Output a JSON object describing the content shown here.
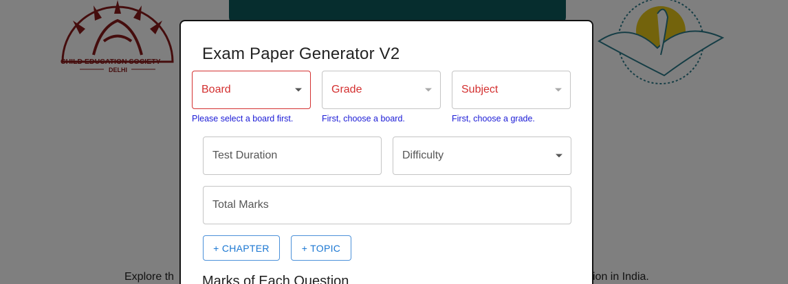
{
  "background": {
    "left_logo_text": "CHILD EDUCATION SOCIETY",
    "left_logo_sub": "DELHI",
    "intro_left": "Explore th",
    "intro_right": "ion in India."
  },
  "modal": {
    "title": "Exam Paper Generator V2",
    "board": {
      "label": "Board",
      "helper": "Please select a board first."
    },
    "grade": {
      "label": "Grade",
      "helper": "First, choose a board."
    },
    "subject": {
      "label": "Subject",
      "helper": "First, choose a grade."
    },
    "test_duration": {
      "placeholder": "Test Duration"
    },
    "difficulty": {
      "label": "Difficulty"
    },
    "total_marks": {
      "placeholder": "Total Marks"
    },
    "add_chapter_label": "+ CHAPTER",
    "add_topic_label": "+ TOPIC",
    "marks_section_heading": "Marks of Each Question"
  },
  "colors": {
    "error": "#d32f2f",
    "helper": "#1a1ad6",
    "accent": "#1976d2",
    "banner": "#0c5a5c"
  }
}
